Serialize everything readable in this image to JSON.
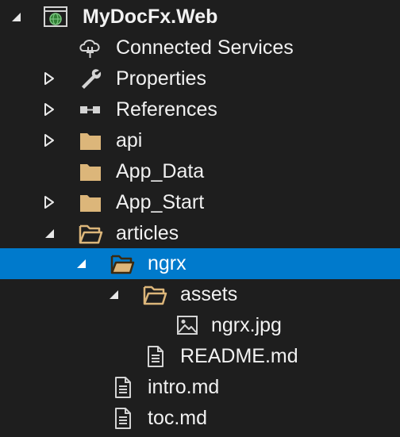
{
  "colors": {
    "background": "#1e1e1e",
    "selection": "#007acc",
    "text": "#f1f1f1",
    "folder": "#dcb67a",
    "icon": "#d4d4d4"
  },
  "tree": {
    "project": {
      "label": "MyDocFx.Web",
      "icon": "web-project-icon",
      "expanded": true
    },
    "connected_services": {
      "label": "Connected Services",
      "icon": "cloud-plug-icon"
    },
    "properties": {
      "label": "Properties",
      "icon": "wrench-icon",
      "expanded": false
    },
    "references": {
      "label": "References",
      "icon": "references-icon",
      "expanded": false
    },
    "api": {
      "label": "api",
      "icon": "folder-icon",
      "expanded": false
    },
    "app_data": {
      "label": "App_Data",
      "icon": "folder-icon"
    },
    "app_start": {
      "label": "App_Start",
      "icon": "folder-icon",
      "expanded": false
    },
    "articles": {
      "label": "articles",
      "icon": "folder-open-icon",
      "expanded": true
    },
    "ngrx": {
      "label": "ngrx",
      "icon": "folder-open-icon",
      "expanded": true,
      "selected": true
    },
    "assets": {
      "label": "assets",
      "icon": "folder-open-icon",
      "expanded": true
    },
    "ngrx_jpg": {
      "label": "ngrx.jpg",
      "icon": "image-file-icon"
    },
    "readme": {
      "label": "README.md",
      "icon": "text-file-icon"
    },
    "intro": {
      "label": "intro.md",
      "icon": "text-file-icon"
    },
    "toc": {
      "label": "toc.md",
      "icon": "text-file-icon"
    }
  }
}
